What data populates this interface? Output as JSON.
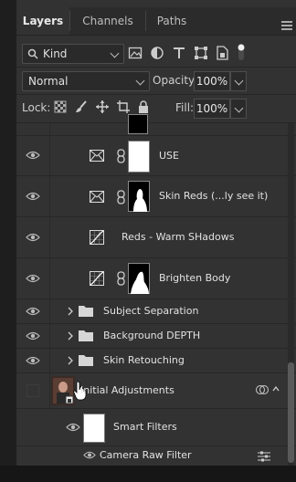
{
  "tabs": [
    {
      "label": "Layers"
    },
    {
      "label": "Channels"
    },
    {
      "label": "Paths"
    }
  ],
  "filter": {
    "kind_label": "Kind"
  },
  "blend": {
    "mode": "Normal",
    "opacity_label": "Opacity:",
    "opacity_value": "100%"
  },
  "lock": {
    "label": "Lock:",
    "fill_label": "Fill:",
    "fill_value": "100%"
  },
  "layers": [
    {
      "name": "USE"
    },
    {
      "name": "Skin Reds (...ly see it)"
    },
    {
      "name": "Reds - Warm SHadows"
    },
    {
      "name": "Brighten Body"
    },
    {
      "name": "Subject Separation"
    },
    {
      "name": "Background DEPTH"
    },
    {
      "name": "Skin Retouching"
    },
    {
      "name": "Initial Adjustments"
    },
    {
      "name": "Smart Filters"
    },
    {
      "name": "Camera Raw Filter"
    }
  ],
  "colors": {
    "panel": "#323232",
    "text": "#e2e2e2"
  }
}
